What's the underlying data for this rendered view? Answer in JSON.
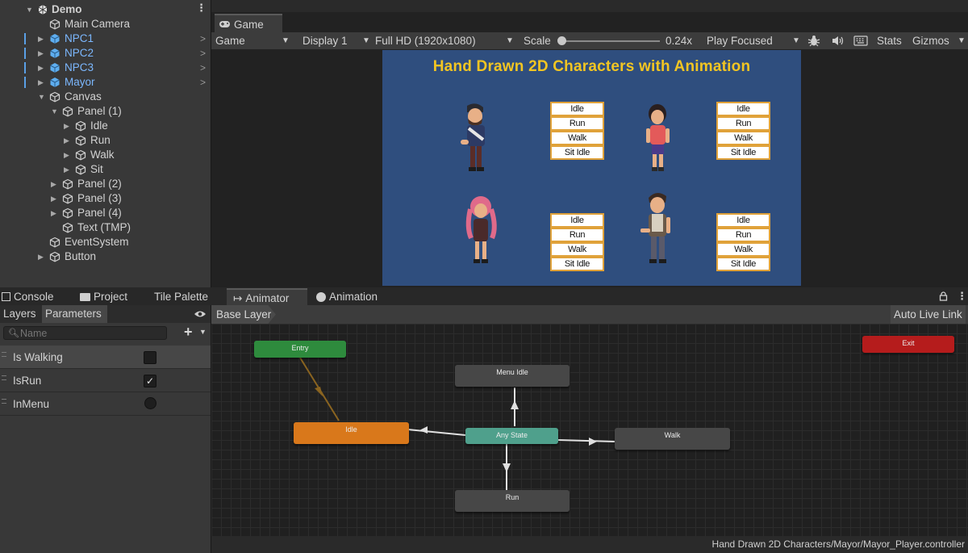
{
  "hierarchy": {
    "items": [
      {
        "label": "Demo"
      },
      {
        "label": "Main Camera"
      },
      {
        "label": "NPC1"
      },
      {
        "label": "NPC2"
      },
      {
        "label": "NPC3"
      },
      {
        "label": "Mayor"
      },
      {
        "label": "Canvas"
      },
      {
        "label": "Panel (1)"
      },
      {
        "label": "Idle"
      },
      {
        "label": "Run"
      },
      {
        "label": "Walk"
      },
      {
        "label": "Sit"
      },
      {
        "label": "Panel (2)"
      },
      {
        "label": "Panel (3)"
      },
      {
        "label": "Panel (4)"
      },
      {
        "label": "Text (TMP)"
      },
      {
        "label": "EventSystem"
      },
      {
        "label": "Button"
      }
    ]
  },
  "game": {
    "tab_label": "Game",
    "toolbar": {
      "view_mode": "Game",
      "display": "Display 1",
      "resolution": "Full HD (1920x1080)",
      "scale_label": "Scale",
      "scale_value": "0.24x",
      "scale_fraction": 0.0,
      "play_mode": "Play Focused",
      "stats": "Stats",
      "gizmos": "Gizmos"
    },
    "title": "Hand Drawn 2D Characters with Animation",
    "panels": [
      {
        "buttons": [
          "Idle",
          "Run",
          "Walk",
          "Sit Idle"
        ]
      },
      {
        "buttons": [
          "Idle",
          "Run",
          "Walk",
          "Sit Idle"
        ]
      },
      {
        "buttons": [
          "Idle",
          "Run",
          "Walk",
          "Sit Idle"
        ]
      },
      {
        "buttons": [
          "Idle",
          "Run",
          "Walk",
          "Sit Idle"
        ]
      }
    ]
  },
  "bottom_tabs": {
    "console": "Console",
    "project": "Project",
    "tile_palette": "Tile Palette",
    "animator": "Animator",
    "animation": "Animation"
  },
  "parameters": {
    "tabs": {
      "layers": "Layers",
      "parameters": "Parameters"
    },
    "search_placeholder": "Name",
    "items": [
      {
        "name": "Is Walking",
        "type": "bool",
        "value": false
      },
      {
        "name": "IsRun",
        "type": "bool",
        "value": true,
        "check": "✓"
      },
      {
        "name": "InMenu",
        "type": "trigger"
      }
    ]
  },
  "animator": {
    "breadcrumb": "Base Layer",
    "auto_live_link": "Auto Live Link",
    "states": {
      "entry": "Entry",
      "exit": "Exit",
      "menu_idle": "Menu Idle",
      "idle": "Idle",
      "any_state": "Any State",
      "walk": "Walk",
      "run": "Run"
    },
    "footer_path": "Hand Drawn 2D Characters/Mayor/Mayor_Player.controller"
  },
  "colors": {
    "entry": "#2e8b3d",
    "exit": "#b51c1c",
    "default_state": "#d9781b",
    "any_state": "#4fa08c",
    "state": "#474747",
    "game_bg": "#2f4e7e",
    "game_title": "#f2c522",
    "button_border": "#e0a23a"
  }
}
